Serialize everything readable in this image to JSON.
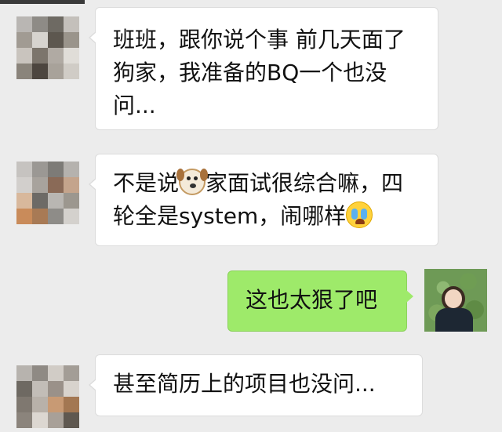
{
  "messages": [
    {
      "side": "in",
      "text": "班班，跟你说个事 前几天面了狗家，我准备的BQ一个也没问..."
    },
    {
      "side": "in",
      "text_a": "不是说",
      "emoji_1": "dog-face-emoji",
      "text_b": "家面试很综合嘛，四轮全是system，闹哪样",
      "emoji_2": "crying-face-emoji"
    },
    {
      "side": "out",
      "text": "这也太狠了吧"
    },
    {
      "side": "in",
      "text": "甚至简历上的项目也没问..."
    }
  ],
  "colors": {
    "background": "#ececec",
    "incoming_bubble": "#ffffff",
    "outgoing_bubble": "#9eea6a"
  }
}
